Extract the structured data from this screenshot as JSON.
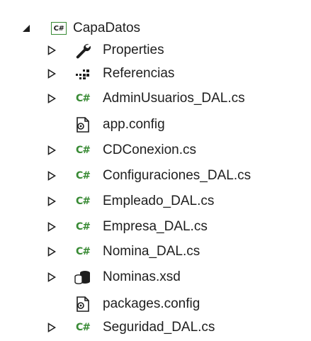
{
  "tree": {
    "root": {
      "label": "CapaDatos",
      "icon": "csharp-project-icon",
      "expanded": true
    },
    "items": [
      {
        "label": "Properties",
        "icon": "wrench-icon",
        "expandable": true
      },
      {
        "label": "Referencias",
        "icon": "references-icon",
        "expandable": true
      },
      {
        "label": "AdminUsuarios_DAL.cs",
        "icon": "csharp-file-icon",
        "expandable": true
      },
      {
        "label": "app.config",
        "icon": "config-file-icon",
        "expandable": false
      },
      {
        "label": "CDConexion.cs",
        "icon": "csharp-file-icon",
        "expandable": true
      },
      {
        "label": "Configuraciones_DAL.cs",
        "icon": "csharp-file-icon",
        "expandable": true
      },
      {
        "label": "Empleado_DAL.cs",
        "icon": "csharp-file-icon",
        "expandable": true
      },
      {
        "label": "Empresa_DAL.cs",
        "icon": "csharp-file-icon",
        "expandable": true
      },
      {
        "label": "Nomina_DAL.cs",
        "icon": "csharp-file-icon",
        "expandable": true
      },
      {
        "label": "Nominas.xsd",
        "icon": "dataset-icon",
        "expandable": true
      },
      {
        "label": "packages.config",
        "icon": "config-file-icon",
        "expandable": false
      },
      {
        "label": "Seguridad_DAL.cs",
        "icon": "csharp-file-icon",
        "expandable": true
      }
    ]
  },
  "colors": {
    "csharp_green": "#388a34",
    "text": "#1e1e1e",
    "expander": "#1e1e1e"
  }
}
